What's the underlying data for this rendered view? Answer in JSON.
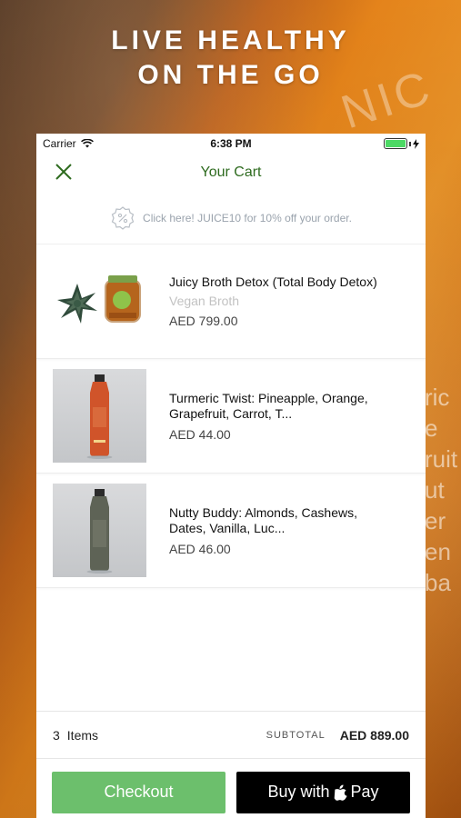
{
  "promo_banner": {
    "headline_line1": "LIVE HEALTHY",
    "headline_line2": "ON THE GO"
  },
  "background_brand": "NIC",
  "background_side_text": "ric e ruit ut er en ba",
  "status_bar": {
    "carrier": "Carrier",
    "time": "6:38 PM"
  },
  "nav": {
    "title": "Your Cart",
    "close_icon": "close-icon"
  },
  "promo": {
    "icon": "percent-badge-icon",
    "text": "Click here! JUICE10 for 10% off your order."
  },
  "cart_items": [
    {
      "name": "Juicy Broth Detox (Total Body Detox)",
      "subtitle": "Vegan Broth",
      "price": "AED 799.00"
    },
    {
      "name": "Turmeric Twist: Pineapple, Orange, Grapefruit, Carrot, T...",
      "subtitle": "",
      "price": "AED 44.00"
    },
    {
      "name": "Nutty Buddy: Almonds, Cashews, Dates, Vanilla, Luc...",
      "subtitle": "",
      "price": "AED 46.00"
    }
  ],
  "summary": {
    "item_count": "3",
    "items_label": "Items",
    "subtotal_label": "SUBTOTAL",
    "subtotal_value": "AED 889.00"
  },
  "actions": {
    "checkout_label": "Checkout",
    "apple_pay_label": "Buy with",
    "apple_pay_suffix": "Pay"
  },
  "colors": {
    "accent_green": "#2e6b1f",
    "checkout_green": "#6cbf6c",
    "battery_green": "#4cd964"
  }
}
